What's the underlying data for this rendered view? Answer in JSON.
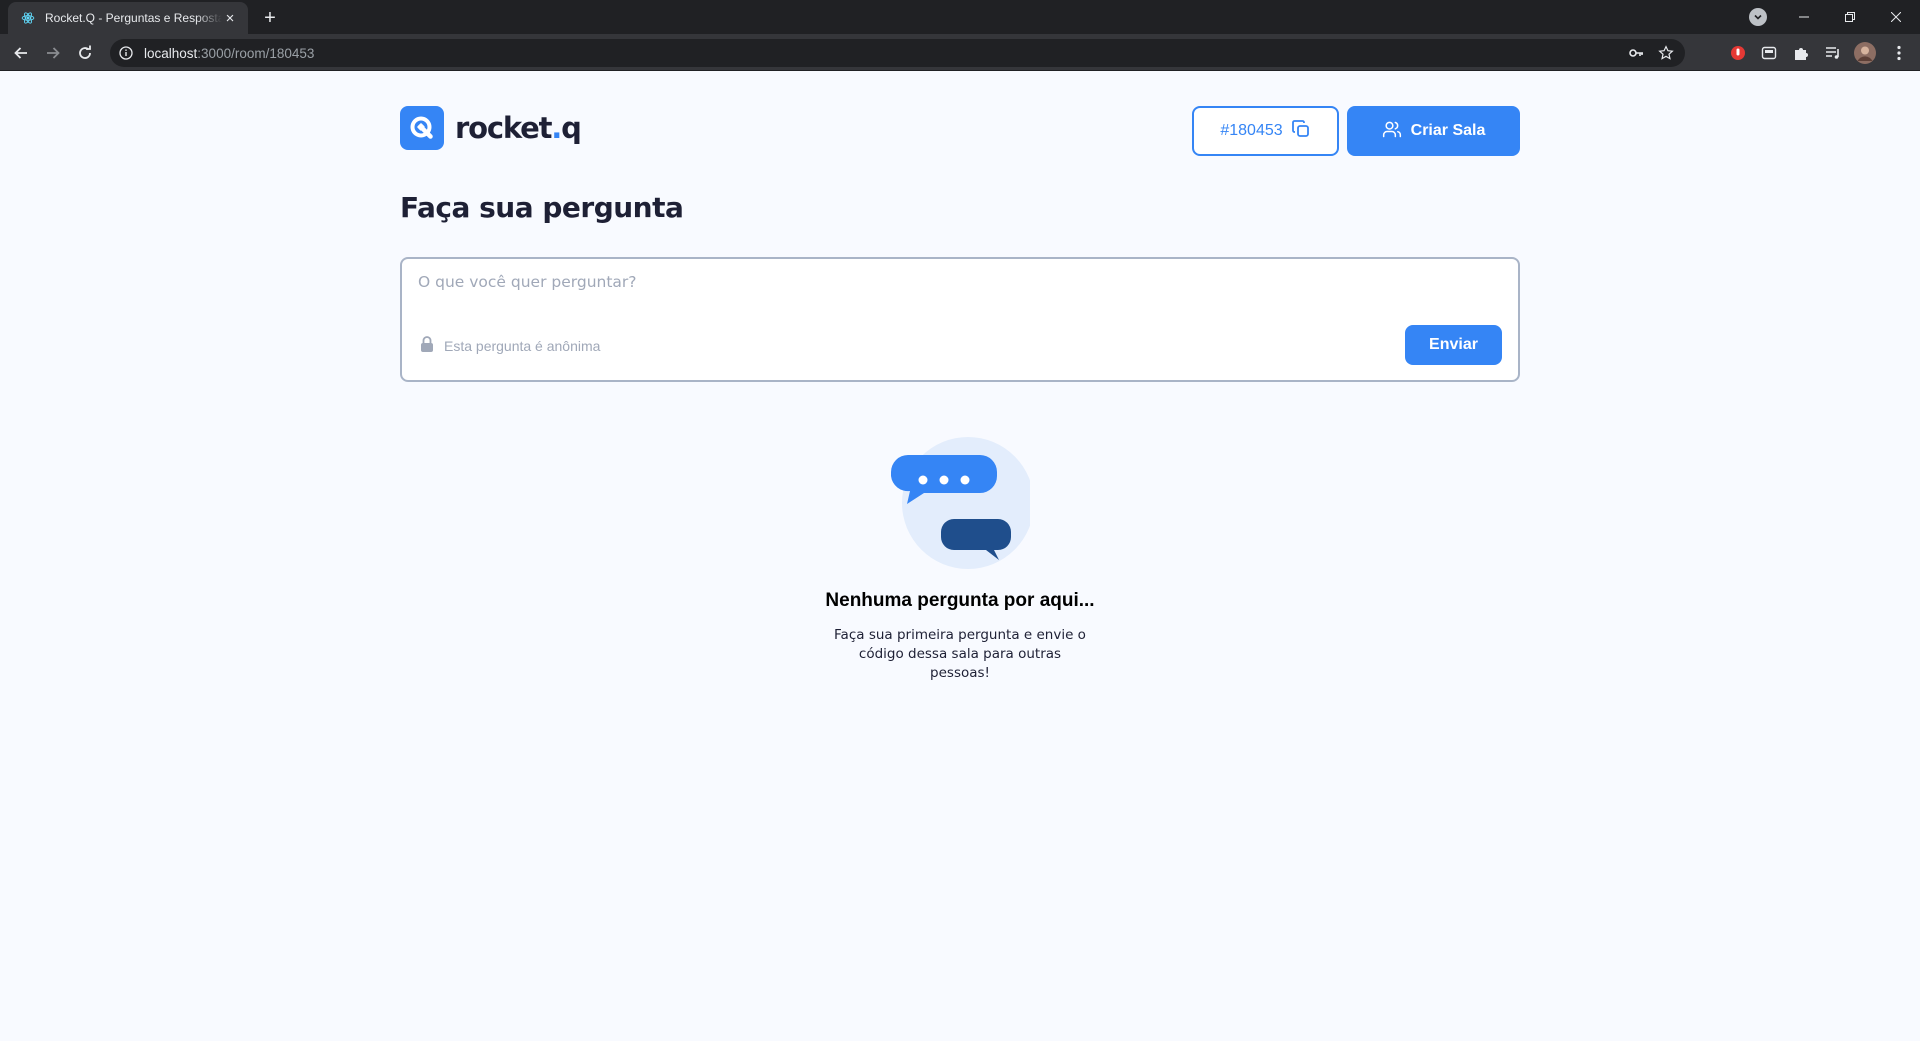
{
  "browser": {
    "tab_title": "Rocket.Q - Perguntas e Respostas",
    "tab_close": "×",
    "new_tab": "+",
    "url_host": "localhost",
    "url_rest": ":3000/room/180453"
  },
  "header": {
    "logo_text": "rocket",
    "logo_dot": ".",
    "logo_q": "q",
    "room_code": "#180453",
    "create_room_label": "Criar Sala"
  },
  "main": {
    "title": "Faça sua pergunta",
    "question_placeholder": "O que você quer perguntar?",
    "anonymous_label": "Esta pergunta é anônima",
    "send_label": "Enviar"
  },
  "empty_state": {
    "title": "Nenhuma pergunta por aqui...",
    "line1": "Faça sua primeira pergunta e envie o",
    "line2": "código dessa sala para outras pessoas!"
  },
  "colors": {
    "primary": "#3585F5",
    "dark": "#1E2035",
    "bubble_dark": "#1F4E8C",
    "illus_bg": "#E3EDFC",
    "page_bg": "#F8FAFF"
  },
  "icons": {
    "favicon": "react-icon",
    "back": "arrow-left-icon",
    "forward": "arrow-right-icon",
    "reload": "reload-icon",
    "site_info": "info-icon",
    "password_key": "key-icon",
    "bookmark": "star-icon",
    "copy": "copy-icon",
    "users": "users-icon",
    "lock": "lock-icon",
    "chat": "chat-bubbles-icon"
  }
}
